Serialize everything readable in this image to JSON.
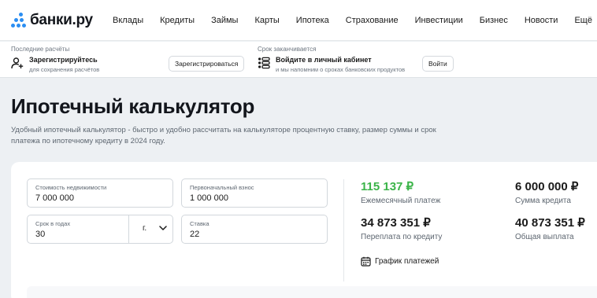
{
  "header": {
    "logo_text": "банки.ру",
    "nav": [
      "Вклады",
      "Кредиты",
      "Займы",
      "Карты",
      "Ипотека",
      "Страхование",
      "Инвестиции",
      "Бизнес",
      "Новости",
      "Ещё"
    ]
  },
  "subbar": {
    "left": {
      "caption": "Последние расчёты",
      "title": "Зарегистрируйтесь",
      "description": "для сохранения расчётов",
      "button": "Зарегистрироваться",
      "icon": "add-user-icon"
    },
    "right": {
      "caption": "Срок заканчивается",
      "title": "Войдите в личный кабинет",
      "description": "и мы напомним о сроках банковских продуктов",
      "button": "Войти",
      "icon": "list-icon"
    }
  },
  "page": {
    "title": "Ипотечный калькулятор",
    "description": "Удобный ипотечный калькулятор - быстро и удобно рассчитать на калькуляторе процентную ставку, размер суммы и срок платежа по ипотечному кредиту в 2024 году."
  },
  "calculator": {
    "property_value": {
      "label": "Стоимость недвижимости",
      "value": "7 000 000"
    },
    "down_payment": {
      "label": "Первоначальный взнос",
      "value": "1 000 000"
    },
    "term": {
      "label": "Срок в годах",
      "value": "30",
      "unit": "г."
    },
    "rate": {
      "label": "Ставка",
      "value": "22"
    }
  },
  "results": {
    "monthly_payment": {
      "value": "115 137 ₽",
      "label": "Ежемесячный платеж"
    },
    "loan_amount": {
      "value": "6 000 000 ₽",
      "label": "Сумма кредита"
    },
    "overpayment": {
      "value": "34 873 351 ₽",
      "label": "Переплата по кредиту"
    },
    "total_payment": {
      "value": "40 873 351 ₽",
      "label": "Общая выплата"
    },
    "schedule_link": "График платежей"
  },
  "colors": {
    "brand_blue": "#2b8ef2",
    "accent_green": "#3bb449",
    "page_bg": "#edf0f3"
  }
}
